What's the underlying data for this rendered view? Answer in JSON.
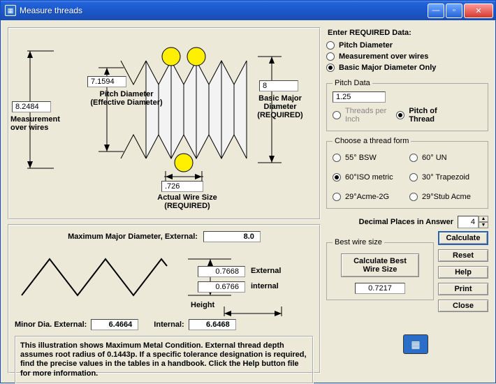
{
  "window": {
    "title": "Measure threads"
  },
  "illus": {
    "mow_value": "8.2484",
    "mow_label": "Measurement\nover wires",
    "pd_value": "7.1594",
    "pd_label": "Pitch Diameter\n(Effective  Diameter)",
    "bmd_value": "8",
    "bmd_label": "Basic Major\nDiameter\n(REQUIRED)",
    "wire_value": ".726",
    "wire_label": "Actual Wire Size\n(REQUIRED)"
  },
  "lower": {
    "maxmaj_label": "Maximum Major Diameter, External:",
    "maxmaj_value": "8.0",
    "ext_val": "0.7668",
    "ext_label": "External",
    "int_val": "0.6766",
    "int_label": "internal",
    "height_label": "Height",
    "minor_ext_label": "Minor Dia. External:",
    "minor_ext_val": "6.4664",
    "internal_label": "Internal:",
    "internal_val": "6.6468",
    "note": "This illustration shows Maximum Metal Condition. External thread depth assumes root radius of 0.1443p. If a specific tolerance designation is required, find the precise values in the tables in a handbook. Click the Help button file for more information."
  },
  "required": {
    "heading": "Enter REQUIRED Data:",
    "opt1": "Pitch Diameter",
    "opt2": "Measurement over wires",
    "opt3": "Basic Major Diameter Only"
  },
  "pitch": {
    "legend": "Pitch Data",
    "value": "1.25",
    "tpi": "Threads per\nInch",
    "pot": "Pitch of\nThread"
  },
  "form": {
    "legend": "Choose a thread form",
    "o1": "55° BSW",
    "o2": "60° UN",
    "o3": "60°ISO metric",
    "o4": "30° Trapezoid",
    "o5": "29°Acme-2G",
    "o6": "29°Stub Acme"
  },
  "decimal": {
    "label": "Decimal Places in Answer",
    "value": "4"
  },
  "best": {
    "legend": "Best wire size",
    "btn": "Calculate Best\nWire Size",
    "value": "0.7217"
  },
  "buttons": {
    "calculate": "Calculate",
    "reset": "Reset",
    "help": "Help",
    "print": "Print",
    "close": "Close"
  }
}
